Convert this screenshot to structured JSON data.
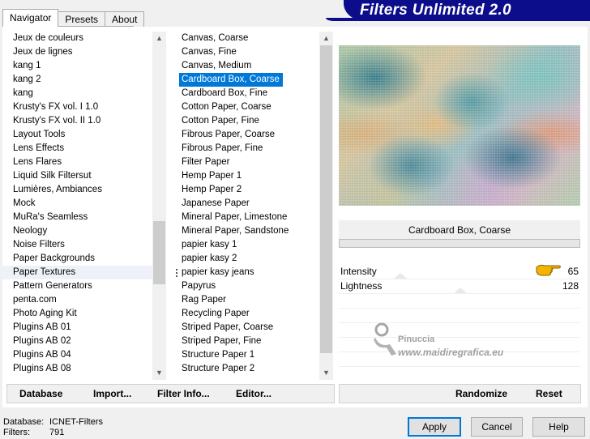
{
  "tabs": [
    "Navigator",
    "Presets",
    "About"
  ],
  "banner_title": "Filters Unlimited 2.0",
  "categories": {
    "items": [
      "Jeux de couleurs",
      "Jeux de lignes",
      "kang 1",
      "kang 2",
      "kang",
      "Krusty's FX vol. I 1.0",
      "Krusty's FX vol. II 1.0",
      "Layout Tools",
      "Lens Effects",
      "Lens Flares",
      "Liquid Silk Filtersut",
      "Lumières, Ambiances",
      "Mock",
      "MuRa's Seamless",
      "Neology",
      "Noise Filters",
      "Paper Backgrounds",
      "Paper Textures",
      "Pattern Generators",
      "penta.com",
      "Photo Aging Kit",
      "Plugins AB 01",
      "Plugins AB 02",
      "Plugins AB 04",
      "Plugins AB 08"
    ],
    "highlighted": "Paper Textures"
  },
  "filters": {
    "items": [
      "Canvas, Coarse",
      "Canvas, Fine",
      "Canvas, Medium",
      "Cardboard Box, Coarse",
      "Cardboard Box, Fine",
      "Cotton Paper, Coarse",
      "Cotton Paper, Fine",
      "Fibrous Paper, Coarse",
      "Fibrous Paper, Fine",
      "Filter Paper",
      "Hemp Paper 1",
      "Hemp Paper 2",
      "Japanese Paper",
      "Mineral Paper, Limestone",
      "Mineral Paper, Sandstone",
      "papier kasy 1",
      "papier kasy 2",
      "papier kasy jeans",
      "Papyrus",
      "Rag Paper",
      "Recycling Paper",
      "Striped Paper, Coarse",
      "Striped Paper, Fine",
      "Structure Paper 1",
      "Structure Paper 2"
    ],
    "selected": "Cardboard Box, Coarse"
  },
  "preview": {
    "filter_name": "Cardboard Box, Coarse"
  },
  "sliders": [
    {
      "label": "Intensity",
      "value": "65"
    },
    {
      "label": "Lightness",
      "value": "128"
    }
  ],
  "watermark": {
    "name": "Pinuccia",
    "site": "www.maidiregrafica.eu"
  },
  "left_buttons": {
    "database": "Database",
    "import": "Import...",
    "filter_info": "Filter Info...",
    "editor": "Editor..."
  },
  "right_buttons": {
    "randomize": "Randomize",
    "reset": "Reset"
  },
  "status": {
    "database_label": "Database:",
    "database_value": "ICNET-Filters",
    "filters_label": "Filters:",
    "filters_value": "791"
  },
  "dialog_buttons": {
    "apply": "Apply",
    "cancel": "Cancel",
    "help": "Help"
  },
  "colors": {
    "banner": "#0b0d8a",
    "selection": "#0078d7",
    "hand_icon": "#e2ad00"
  }
}
